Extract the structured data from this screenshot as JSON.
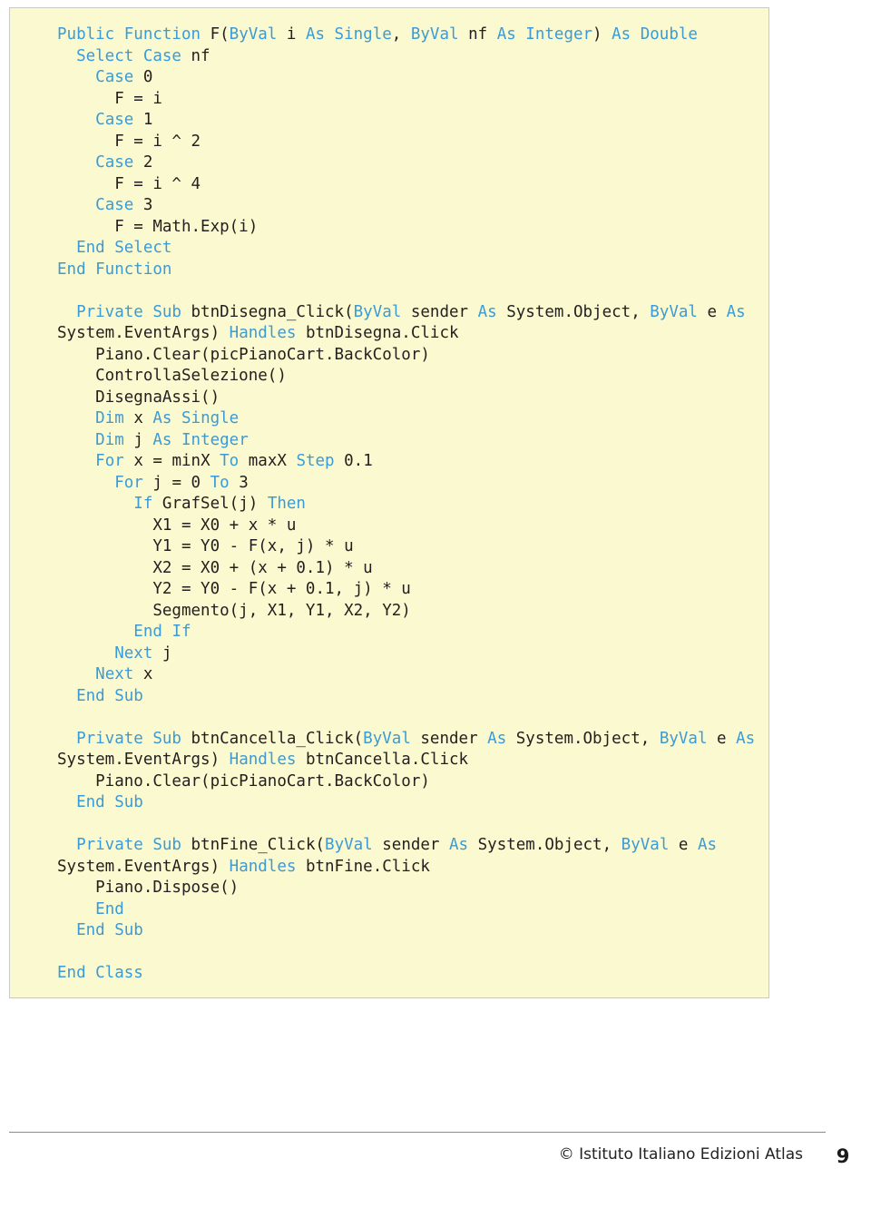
{
  "document": {
    "code_block": {
      "background_color": "#fbf9cf",
      "keyword_color": "#3b9bd6",
      "text_color": "#221f1f",
      "lines": [
        [
          {
            "t": "Public Function ",
            "k": true
          },
          {
            "t": "F(",
            "k": false
          },
          {
            "t": "ByVal ",
            "k": true
          },
          {
            "t": "i ",
            "k": false
          },
          {
            "t": "As Single",
            "k": true
          },
          {
            "t": ", ",
            "k": false
          },
          {
            "t": "ByVal ",
            "k": true
          },
          {
            "t": "nf ",
            "k": false
          },
          {
            "t": "As Integer",
            "k": true
          },
          {
            "t": ") ",
            "k": false
          },
          {
            "t": "As Double",
            "k": true
          }
        ],
        [
          {
            "t": "  ",
            "k": false
          },
          {
            "t": "Select Case ",
            "k": true
          },
          {
            "t": "nf",
            "k": false
          }
        ],
        [
          {
            "t": "    ",
            "k": false
          },
          {
            "t": "Case ",
            "k": true
          },
          {
            "t": "0",
            "k": false
          }
        ],
        [
          {
            "t": "      F = i",
            "k": false
          }
        ],
        [
          {
            "t": "    ",
            "k": false
          },
          {
            "t": "Case ",
            "k": true
          },
          {
            "t": "1",
            "k": false
          }
        ],
        [
          {
            "t": "      F = i ^ 2",
            "k": false
          }
        ],
        [
          {
            "t": "    ",
            "k": false
          },
          {
            "t": "Case ",
            "k": true
          },
          {
            "t": "2",
            "k": false
          }
        ],
        [
          {
            "t": "      F = i ^ 4",
            "k": false
          }
        ],
        [
          {
            "t": "    ",
            "k": false
          },
          {
            "t": "Case ",
            "k": true
          },
          {
            "t": "3",
            "k": false
          }
        ],
        [
          {
            "t": "      F = Math.Exp(i)",
            "k": false
          }
        ],
        [
          {
            "t": "  ",
            "k": false
          },
          {
            "t": "End Select",
            "k": true
          }
        ],
        [
          {
            "t": "End Function",
            "k": true
          }
        ],
        [],
        [
          {
            "t": "  ",
            "k": false
          },
          {
            "t": "Private Sub ",
            "k": true
          },
          {
            "t": "btnDisegna_Click(",
            "k": false
          },
          {
            "t": "ByVal ",
            "k": true
          },
          {
            "t": "sender ",
            "k": false
          },
          {
            "t": "As ",
            "k": true
          },
          {
            "t": "System.Object, ",
            "k": false
          },
          {
            "t": "ByVal ",
            "k": true
          },
          {
            "t": "e ",
            "k": false
          },
          {
            "t": "As",
            "k": true
          }
        ],
        [
          {
            "t": "System.EventArgs) ",
            "k": false
          },
          {
            "t": "Handles ",
            "k": true
          },
          {
            "t": "btnDisegna.Click",
            "k": false
          }
        ],
        [
          {
            "t": "    Piano.Clear(picPianoCart.BackColor)",
            "k": false
          }
        ],
        [
          {
            "t": "    ControllaSelezione()",
            "k": false
          }
        ],
        [
          {
            "t": "    DisegnaAssi()",
            "k": false
          }
        ],
        [
          {
            "t": "    ",
            "k": false
          },
          {
            "t": "Dim ",
            "k": true
          },
          {
            "t": "x ",
            "k": false
          },
          {
            "t": "As Single",
            "k": true
          }
        ],
        [
          {
            "t": "    ",
            "k": false
          },
          {
            "t": "Dim ",
            "k": true
          },
          {
            "t": "j ",
            "k": false
          },
          {
            "t": "As Integer",
            "k": true
          }
        ],
        [
          {
            "t": "    ",
            "k": false
          },
          {
            "t": "For ",
            "k": true
          },
          {
            "t": "x = minX ",
            "k": false
          },
          {
            "t": "To ",
            "k": true
          },
          {
            "t": "maxX ",
            "k": false
          },
          {
            "t": "Step ",
            "k": true
          },
          {
            "t": "0.1",
            "k": false
          }
        ],
        [
          {
            "t": "      ",
            "k": false
          },
          {
            "t": "For ",
            "k": true
          },
          {
            "t": "j = 0 ",
            "k": false
          },
          {
            "t": "To ",
            "k": true
          },
          {
            "t": "3",
            "k": false
          }
        ],
        [
          {
            "t": "        ",
            "k": false
          },
          {
            "t": "If ",
            "k": true
          },
          {
            "t": "GrafSel(j) ",
            "k": false
          },
          {
            "t": "Then",
            "k": true
          }
        ],
        [
          {
            "t": "          X1 = X0 + x * u",
            "k": false
          }
        ],
        [
          {
            "t": "          Y1 = Y0 - F(x, j) * u",
            "k": false
          }
        ],
        [
          {
            "t": "          X2 = X0 + (x + 0.1) * u",
            "k": false
          }
        ],
        [
          {
            "t": "          Y2 = Y0 - F(x + 0.1, j) * u",
            "k": false
          }
        ],
        [
          {
            "t": "          Segmento(j, X1, Y1, X2, Y2)",
            "k": false
          }
        ],
        [
          {
            "t": "        ",
            "k": false
          },
          {
            "t": "End If",
            "k": true
          }
        ],
        [
          {
            "t": "      ",
            "k": false
          },
          {
            "t": "Next ",
            "k": true
          },
          {
            "t": "j",
            "k": false
          }
        ],
        [
          {
            "t": "    ",
            "k": false
          },
          {
            "t": "Next ",
            "k": true
          },
          {
            "t": "x",
            "k": false
          }
        ],
        [
          {
            "t": "  ",
            "k": false
          },
          {
            "t": "End Sub",
            "k": true
          }
        ],
        [],
        [
          {
            "t": "  ",
            "k": false
          },
          {
            "t": "Private Sub ",
            "k": true
          },
          {
            "t": "btnCancella_Click(",
            "k": false
          },
          {
            "t": "ByVal ",
            "k": true
          },
          {
            "t": "sender ",
            "k": false
          },
          {
            "t": "As ",
            "k": true
          },
          {
            "t": "System.Object, ",
            "k": false
          },
          {
            "t": "ByVal ",
            "k": true
          },
          {
            "t": "e ",
            "k": false
          },
          {
            "t": "As",
            "k": true
          }
        ],
        [
          {
            "t": "System.EventArgs) ",
            "k": false
          },
          {
            "t": "Handles ",
            "k": true
          },
          {
            "t": "btnCancella.Click",
            "k": false
          }
        ],
        [
          {
            "t": "    Piano.Clear(picPianoCart.BackColor)",
            "k": false
          }
        ],
        [
          {
            "t": "  ",
            "k": false
          },
          {
            "t": "End Sub",
            "k": true
          }
        ],
        [],
        [
          {
            "t": "  ",
            "k": false
          },
          {
            "t": "Private Sub ",
            "k": true
          },
          {
            "t": "btnFine_Click(",
            "k": false
          },
          {
            "t": "ByVal ",
            "k": true
          },
          {
            "t": "sender ",
            "k": false
          },
          {
            "t": "As ",
            "k": true
          },
          {
            "t": "System.Object, ",
            "k": false
          },
          {
            "t": "ByVal ",
            "k": true
          },
          {
            "t": "e ",
            "k": false
          },
          {
            "t": "As",
            "k": true
          }
        ],
        [
          {
            "t": "System.EventArgs) ",
            "k": false
          },
          {
            "t": "Handles ",
            "k": true
          },
          {
            "t": "btnFine.Click",
            "k": false
          }
        ],
        [
          {
            "t": "    Piano.Dispose()",
            "k": false
          }
        ],
        [
          {
            "t": "    ",
            "k": false
          },
          {
            "t": "End",
            "k": true
          }
        ],
        [
          {
            "t": "  ",
            "k": false
          },
          {
            "t": "End Sub",
            "k": true
          }
        ],
        [],
        [
          {
            "t": "End Class",
            "k": true
          }
        ]
      ]
    },
    "footer": {
      "copyright": "© Istituto Italiano Edizioni Atlas",
      "page_number": "9"
    }
  }
}
